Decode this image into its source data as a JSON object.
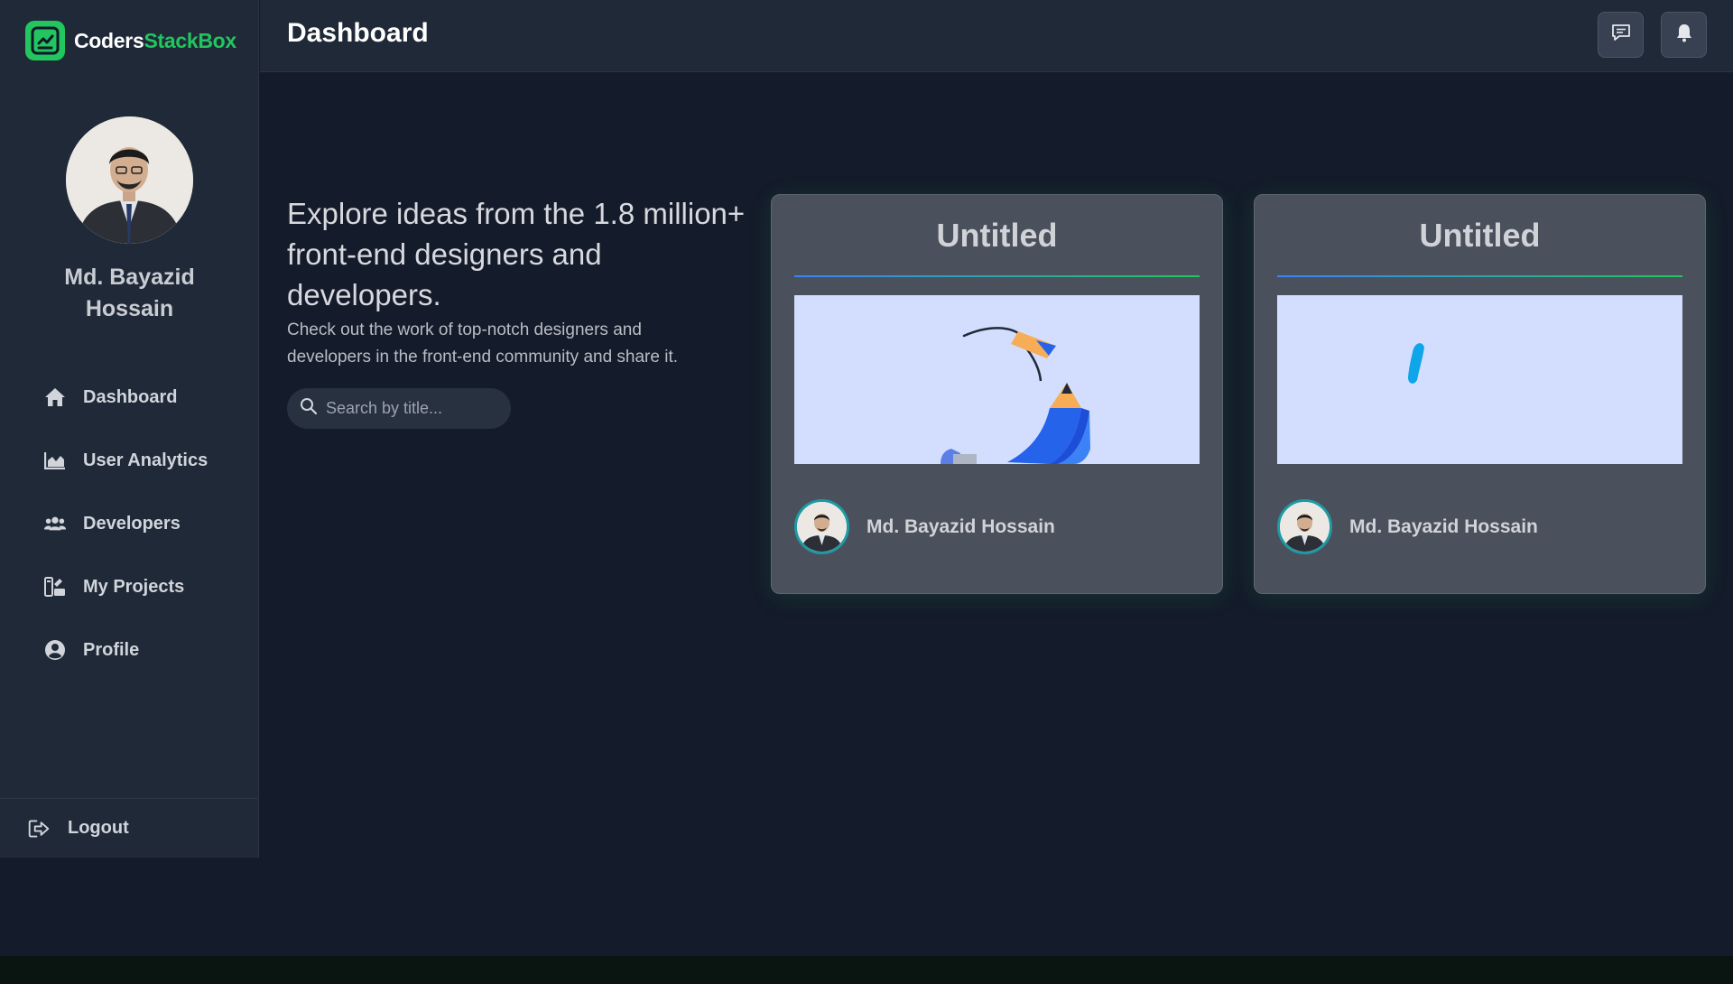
{
  "brand": {
    "name_part1": "Coders",
    "name_part2": "StackBox"
  },
  "sidebar": {
    "user_name": "Md. Bayazid Hossain",
    "items": [
      {
        "label": "Dashboard",
        "icon": "home-icon"
      },
      {
        "label": "User Analytics",
        "icon": "chart-area-icon"
      },
      {
        "label": "Developers",
        "icon": "users-icon"
      },
      {
        "label": "My Projects",
        "icon": "projects-icon"
      },
      {
        "label": "Profile",
        "icon": "user-circle-icon"
      }
    ],
    "logout_label": "Logout"
  },
  "header": {
    "title": "Dashboard",
    "buttons": [
      {
        "icon": "message-icon"
      },
      {
        "icon": "bell-icon"
      }
    ]
  },
  "hero": {
    "title": "Explore ideas from the 1.8 million+ front-end designers and developers.",
    "subtitle": "Check out the work of top-notch designers and developers in the front-end community and share it.",
    "search_placeholder": "Search by title..."
  },
  "cards": [
    {
      "title": "Untitled",
      "author": "Md. Bayazid Hossain"
    },
    {
      "title": "Untitled",
      "author": "Md. Bayazid Hossain"
    }
  ],
  "colors": {
    "brand_green": "#22c55e",
    "sidebar_bg": "#1f2937",
    "main_bg": "#141b2a",
    "card_bg": "#4b515c",
    "accent_blue": "#3b82f6"
  }
}
